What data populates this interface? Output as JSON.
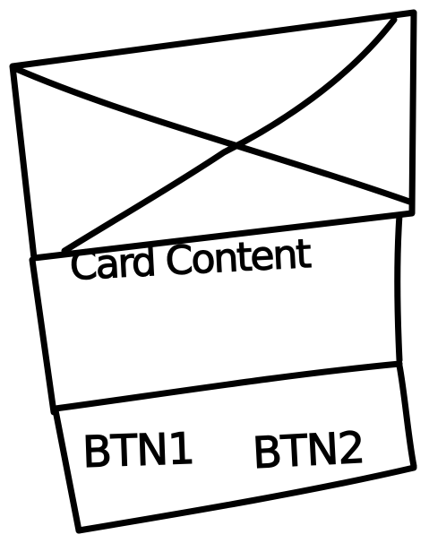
{
  "card": {
    "content_label": "Card Content",
    "buttons": [
      {
        "label": "BTN1"
      },
      {
        "label": "BTN2"
      }
    ]
  }
}
